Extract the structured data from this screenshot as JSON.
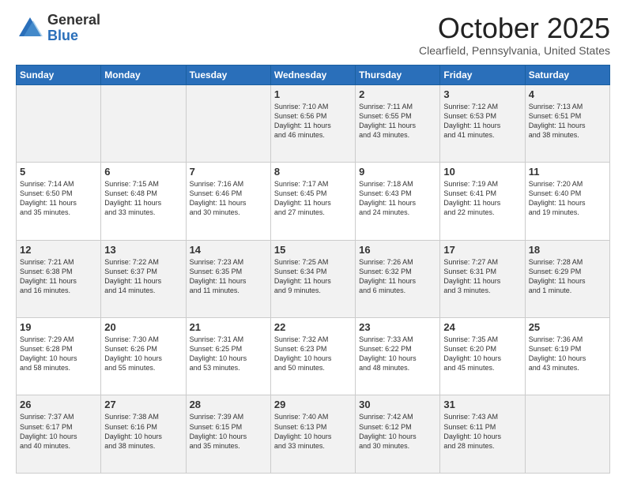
{
  "logo": {
    "general": "General",
    "blue": "Blue"
  },
  "header": {
    "month": "October 2025",
    "location": "Clearfield, Pennsylvania, United States"
  },
  "weekdays": [
    "Sunday",
    "Monday",
    "Tuesday",
    "Wednesday",
    "Thursday",
    "Friday",
    "Saturday"
  ],
  "weeks": [
    [
      {
        "day": "",
        "info": ""
      },
      {
        "day": "",
        "info": ""
      },
      {
        "day": "",
        "info": ""
      },
      {
        "day": "1",
        "info": "Sunrise: 7:10 AM\nSunset: 6:56 PM\nDaylight: 11 hours\nand 46 minutes."
      },
      {
        "day": "2",
        "info": "Sunrise: 7:11 AM\nSunset: 6:55 PM\nDaylight: 11 hours\nand 43 minutes."
      },
      {
        "day": "3",
        "info": "Sunrise: 7:12 AM\nSunset: 6:53 PM\nDaylight: 11 hours\nand 41 minutes."
      },
      {
        "day": "4",
        "info": "Sunrise: 7:13 AM\nSunset: 6:51 PM\nDaylight: 11 hours\nand 38 minutes."
      }
    ],
    [
      {
        "day": "5",
        "info": "Sunrise: 7:14 AM\nSunset: 6:50 PM\nDaylight: 11 hours\nand 35 minutes."
      },
      {
        "day": "6",
        "info": "Sunrise: 7:15 AM\nSunset: 6:48 PM\nDaylight: 11 hours\nand 33 minutes."
      },
      {
        "day": "7",
        "info": "Sunrise: 7:16 AM\nSunset: 6:46 PM\nDaylight: 11 hours\nand 30 minutes."
      },
      {
        "day": "8",
        "info": "Sunrise: 7:17 AM\nSunset: 6:45 PM\nDaylight: 11 hours\nand 27 minutes."
      },
      {
        "day": "9",
        "info": "Sunrise: 7:18 AM\nSunset: 6:43 PM\nDaylight: 11 hours\nand 24 minutes."
      },
      {
        "day": "10",
        "info": "Sunrise: 7:19 AM\nSunset: 6:41 PM\nDaylight: 11 hours\nand 22 minutes."
      },
      {
        "day": "11",
        "info": "Sunrise: 7:20 AM\nSunset: 6:40 PM\nDaylight: 11 hours\nand 19 minutes."
      }
    ],
    [
      {
        "day": "12",
        "info": "Sunrise: 7:21 AM\nSunset: 6:38 PM\nDaylight: 11 hours\nand 16 minutes."
      },
      {
        "day": "13",
        "info": "Sunrise: 7:22 AM\nSunset: 6:37 PM\nDaylight: 11 hours\nand 14 minutes."
      },
      {
        "day": "14",
        "info": "Sunrise: 7:23 AM\nSunset: 6:35 PM\nDaylight: 11 hours\nand 11 minutes."
      },
      {
        "day": "15",
        "info": "Sunrise: 7:25 AM\nSunset: 6:34 PM\nDaylight: 11 hours\nand 9 minutes."
      },
      {
        "day": "16",
        "info": "Sunrise: 7:26 AM\nSunset: 6:32 PM\nDaylight: 11 hours\nand 6 minutes."
      },
      {
        "day": "17",
        "info": "Sunrise: 7:27 AM\nSunset: 6:31 PM\nDaylight: 11 hours\nand 3 minutes."
      },
      {
        "day": "18",
        "info": "Sunrise: 7:28 AM\nSunset: 6:29 PM\nDaylight: 11 hours\nand 1 minute."
      }
    ],
    [
      {
        "day": "19",
        "info": "Sunrise: 7:29 AM\nSunset: 6:28 PM\nDaylight: 10 hours\nand 58 minutes."
      },
      {
        "day": "20",
        "info": "Sunrise: 7:30 AM\nSunset: 6:26 PM\nDaylight: 10 hours\nand 55 minutes."
      },
      {
        "day": "21",
        "info": "Sunrise: 7:31 AM\nSunset: 6:25 PM\nDaylight: 10 hours\nand 53 minutes."
      },
      {
        "day": "22",
        "info": "Sunrise: 7:32 AM\nSunset: 6:23 PM\nDaylight: 10 hours\nand 50 minutes."
      },
      {
        "day": "23",
        "info": "Sunrise: 7:33 AM\nSunset: 6:22 PM\nDaylight: 10 hours\nand 48 minutes."
      },
      {
        "day": "24",
        "info": "Sunrise: 7:35 AM\nSunset: 6:20 PM\nDaylight: 10 hours\nand 45 minutes."
      },
      {
        "day": "25",
        "info": "Sunrise: 7:36 AM\nSunset: 6:19 PM\nDaylight: 10 hours\nand 43 minutes."
      }
    ],
    [
      {
        "day": "26",
        "info": "Sunrise: 7:37 AM\nSunset: 6:17 PM\nDaylight: 10 hours\nand 40 minutes."
      },
      {
        "day": "27",
        "info": "Sunrise: 7:38 AM\nSunset: 6:16 PM\nDaylight: 10 hours\nand 38 minutes."
      },
      {
        "day": "28",
        "info": "Sunrise: 7:39 AM\nSunset: 6:15 PM\nDaylight: 10 hours\nand 35 minutes."
      },
      {
        "day": "29",
        "info": "Sunrise: 7:40 AM\nSunset: 6:13 PM\nDaylight: 10 hours\nand 33 minutes."
      },
      {
        "day": "30",
        "info": "Sunrise: 7:42 AM\nSunset: 6:12 PM\nDaylight: 10 hours\nand 30 minutes."
      },
      {
        "day": "31",
        "info": "Sunrise: 7:43 AM\nSunset: 6:11 PM\nDaylight: 10 hours\nand 28 minutes."
      },
      {
        "day": "",
        "info": ""
      }
    ]
  ]
}
